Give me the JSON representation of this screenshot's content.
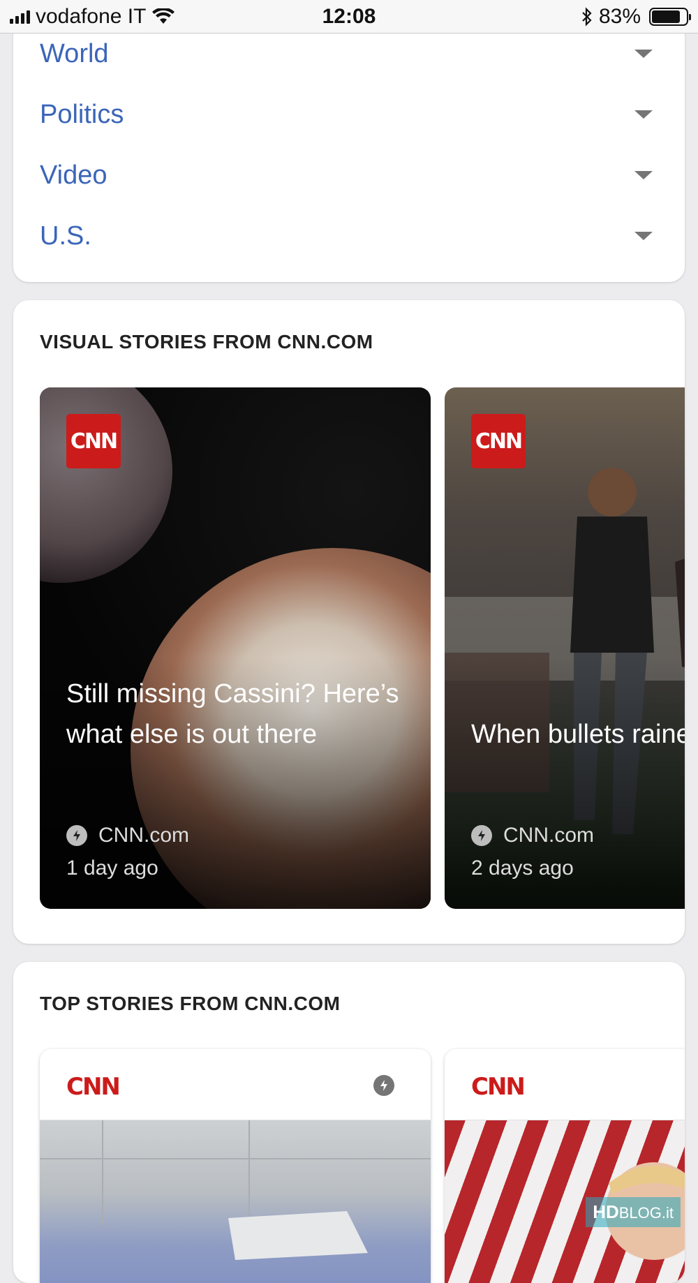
{
  "status_bar": {
    "carrier": "vodafone IT",
    "time": "12:08",
    "battery": "83%",
    "battery_level": 0.83,
    "icons": [
      "signal-icon",
      "wifi-icon",
      "bluetooth-icon",
      "battery-icon"
    ]
  },
  "sections": [
    {
      "label": "World"
    },
    {
      "label": "Politics"
    },
    {
      "label": "Video"
    },
    {
      "label": "U.S."
    }
  ],
  "visual_stories": {
    "heading": "VISUAL STORIES FROM CNN.COM",
    "items": [
      {
        "badge": "CNN",
        "title": "Still missing Cassini? Here’s what else is out there",
        "source": "CNN.com",
        "time": "1 day ago"
      },
      {
        "badge": "CNN",
        "title": "When bullets rained on Las Vegas",
        "source": "CNN.com",
        "time": "2 days ago"
      }
    ]
  },
  "top_stories": {
    "heading": "TOP STORIES FROM CNN.COM",
    "items": [
      {
        "logo": "CNN"
      },
      {
        "logo": "CNN"
      }
    ]
  },
  "watermark": {
    "main": "HD",
    "suffix": "BLOG.it"
  },
  "colors": {
    "link_blue": "#3b65b8",
    "cnn_red": "#cc1b1b"
  }
}
